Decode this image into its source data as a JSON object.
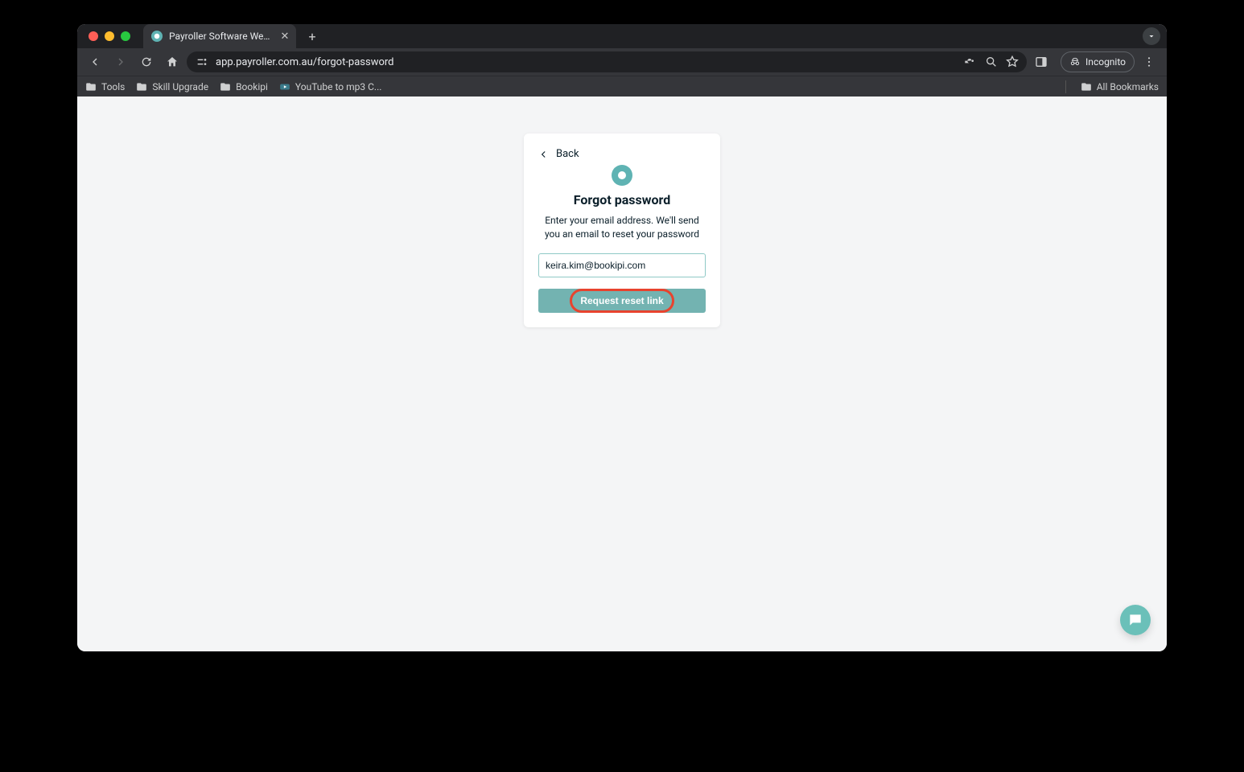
{
  "browser": {
    "tab_title": "Payroller Software Web Appli",
    "url": "app.payroller.com.au/forgot-password",
    "incognito_label": "Incognito"
  },
  "bookmarks": {
    "items": [
      {
        "label": "Tools"
      },
      {
        "label": "Skill Upgrade"
      },
      {
        "label": "Bookipi"
      },
      {
        "label": "YouTube to mp3 C..."
      }
    ],
    "all_label": "All Bookmarks"
  },
  "card": {
    "back_label": "Back",
    "heading": "Forgot password",
    "subtext": "Enter your email address. We'll send you an email to reset your password",
    "email_value": "keira.kim@bookipi.com",
    "button_label": "Request reset link"
  }
}
